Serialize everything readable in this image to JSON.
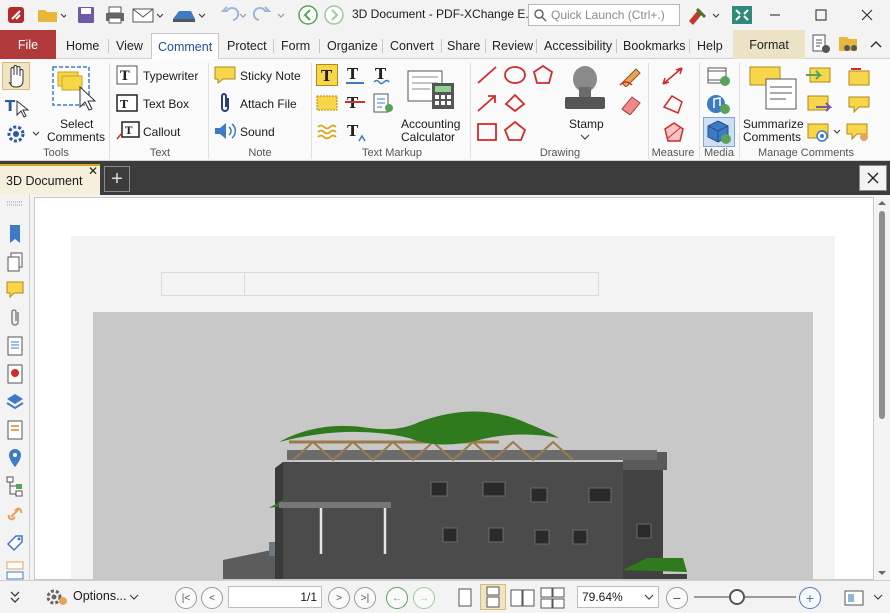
{
  "window": {
    "title": "3D Document - PDF-XChange E...",
    "search_placeholder": "Quick Launch (Ctrl+.)"
  },
  "tabs": [
    {
      "label": "File"
    },
    {
      "label": "Home"
    },
    {
      "label": "View"
    },
    {
      "label": "Comment"
    },
    {
      "label": "Protect"
    },
    {
      "label": "Form"
    },
    {
      "label": "Organize"
    },
    {
      "label": "Convert"
    },
    {
      "label": "Share"
    },
    {
      "label": "Review"
    },
    {
      "label": "Accessibility"
    },
    {
      "label": "Bookmarks"
    },
    {
      "label": "Help"
    },
    {
      "label": "Format"
    }
  ],
  "ribbon": {
    "tools": {
      "label": "Tools",
      "select_comments_line1": "Select",
      "select_comments_line2": "Comments"
    },
    "text": {
      "label": "Text",
      "typewriter": "Typewriter",
      "textbox": "Text Box",
      "callout": "Callout"
    },
    "note": {
      "label": "Note",
      "sticky": "Sticky Note",
      "attach": "Attach File",
      "sound": "Sound"
    },
    "markup": {
      "label": "Text Markup",
      "accounting_line1": "Accounting",
      "accounting_line2": "Calculator"
    },
    "drawing": {
      "label": "Drawing",
      "stamp": "Stamp"
    },
    "measure": {
      "label": "Measure"
    },
    "media": {
      "label": "Media"
    },
    "manage": {
      "label": "Manage Comments",
      "summarize_line1": "Summarize",
      "summarize_line2": "Comments"
    }
  },
  "document_tab": {
    "label": "3D Document"
  },
  "statusbar": {
    "options": "Options...",
    "page": "1/1",
    "zoom": "79.64%"
  },
  "colors": {
    "file_tab": "#b03a3a",
    "active_tab_text": "#1c4e9c",
    "doc_tab_bar": "#3c3c3c",
    "format_tab": "#ece2c6",
    "roof_green": "#2f7a1c",
    "building_gray": "#4d4d4d"
  }
}
